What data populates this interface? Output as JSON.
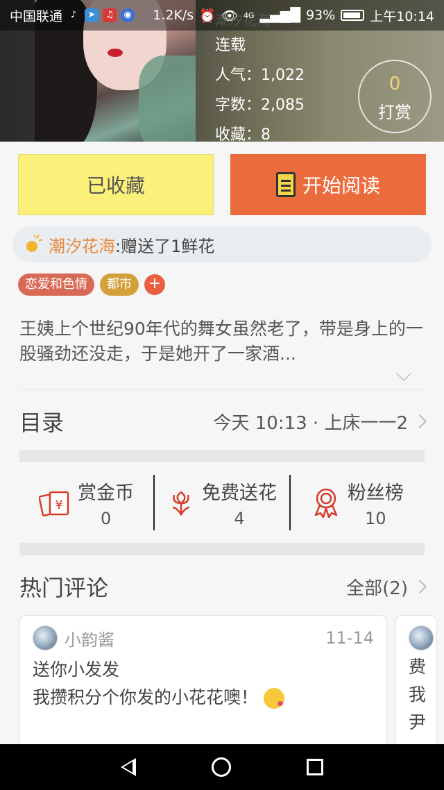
{
  "status_bar": {
    "carrier": "中国联通",
    "speed": "1.2K/s",
    "network": "4G",
    "battery": "93%",
    "time": "上午10:14",
    "icons": [
      "tiktok-icon",
      "telegram-icon",
      "listen-app-icon",
      "globe-app-icon"
    ]
  },
  "book": {
    "author_ghost": "潮汐花海",
    "status": "连载",
    "popularity": "人气：1,022",
    "words": "字数：2,085",
    "favorites": "收藏：8",
    "reward_count": "0",
    "reward_label": "打赏"
  },
  "buttons": {
    "favorited": "已收藏",
    "start_reading": "开始阅读"
  },
  "gift": {
    "sender": "潮汐花海",
    "message": ":赠送了1鲜花"
  },
  "tags": [
    {
      "label": "恋爱和色情",
      "color": "#d86a55"
    },
    {
      "label": "都市",
      "color": "#d3a13a"
    }
  ],
  "tag_add": "+",
  "description": "王姨上个世纪90年代的舞女虽然老了，带是身上的一股骚劲还没走，于是她开了一家酒...",
  "catalog": {
    "title": "目录",
    "latest": "今天 10:13 · 上床一一2"
  },
  "actions": [
    {
      "label": "赏金币",
      "value": "0",
      "icon": "reward-coin-icon"
    },
    {
      "label": "免费送花",
      "value": "4",
      "icon": "flower-icon"
    },
    {
      "label": "粉丝榜",
      "value": "10",
      "icon": "medal-icon"
    }
  ],
  "hot_comments": {
    "title": "热门评论",
    "all_label": "全部(2)"
  },
  "comments": [
    {
      "user": "小韵酱",
      "date": "11-14",
      "line1": "送你小发发",
      "line2": "我攒积分个你发的小花花噢！"
    }
  ],
  "comment_peek": {
    "line1": "费",
    "line2": "我",
    "line3": "尹"
  },
  "colors": {
    "accent_orange": "#ea6b3c",
    "fav_yellow": "#fbf07a",
    "sender_orange": "#e88a3d",
    "icon_red": "#d63c2a"
  }
}
